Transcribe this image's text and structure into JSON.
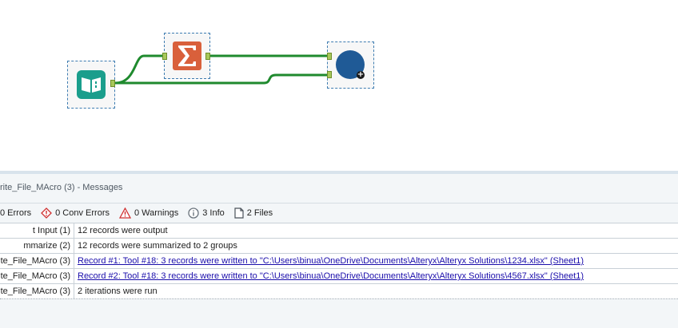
{
  "colors": {
    "wire": "#1f8a2e",
    "input_tool": "#1a9e8c",
    "summarize_tool": "#d9603b",
    "macro_tool": "#1f5a96",
    "link_text": "#1a0dab"
  },
  "canvas": {
    "tools": [
      {
        "name": "input-data-tool",
        "icon": "book-icon"
      },
      {
        "name": "summarize-tool",
        "icon": "sigma-icon"
      },
      {
        "name": "macro-tool",
        "icon": "circle-icon"
      }
    ]
  },
  "messages": {
    "title": "rite_File_MAcro (3) - Messages",
    "filters": {
      "errors": "0 Errors",
      "conv_errors": "0 Conv Errors",
      "warnings": "0 Warnings",
      "info": "3 Info",
      "files": "2 Files"
    },
    "rows": [
      {
        "tool": "t Input (1)",
        "message": "12 records were output",
        "link": false
      },
      {
        "tool": "mmarize (2)",
        "message": "12 records were summarized to 2 groups",
        "link": false
      },
      {
        "tool": "ite_File_MAcro (3)",
        "message": "Record #1: Tool #18: 3 records were written to \"C:\\Users\\binua\\OneDrive\\Documents\\Alteryx\\Alteryx Solutions\\1234.xlsx\" (Sheet1)",
        "link": true
      },
      {
        "tool": "ite_File_MAcro (3)",
        "message": "Record #2: Tool #18: 3 records were written to \"C:\\Users\\binua\\OneDrive\\Documents\\Alteryx\\Alteryx Solutions\\4567.xlsx\" (Sheet1)",
        "link": true
      },
      {
        "tool": "ite_File_MAcro (3)",
        "message": "2 iterations were run",
        "link": false
      }
    ]
  }
}
